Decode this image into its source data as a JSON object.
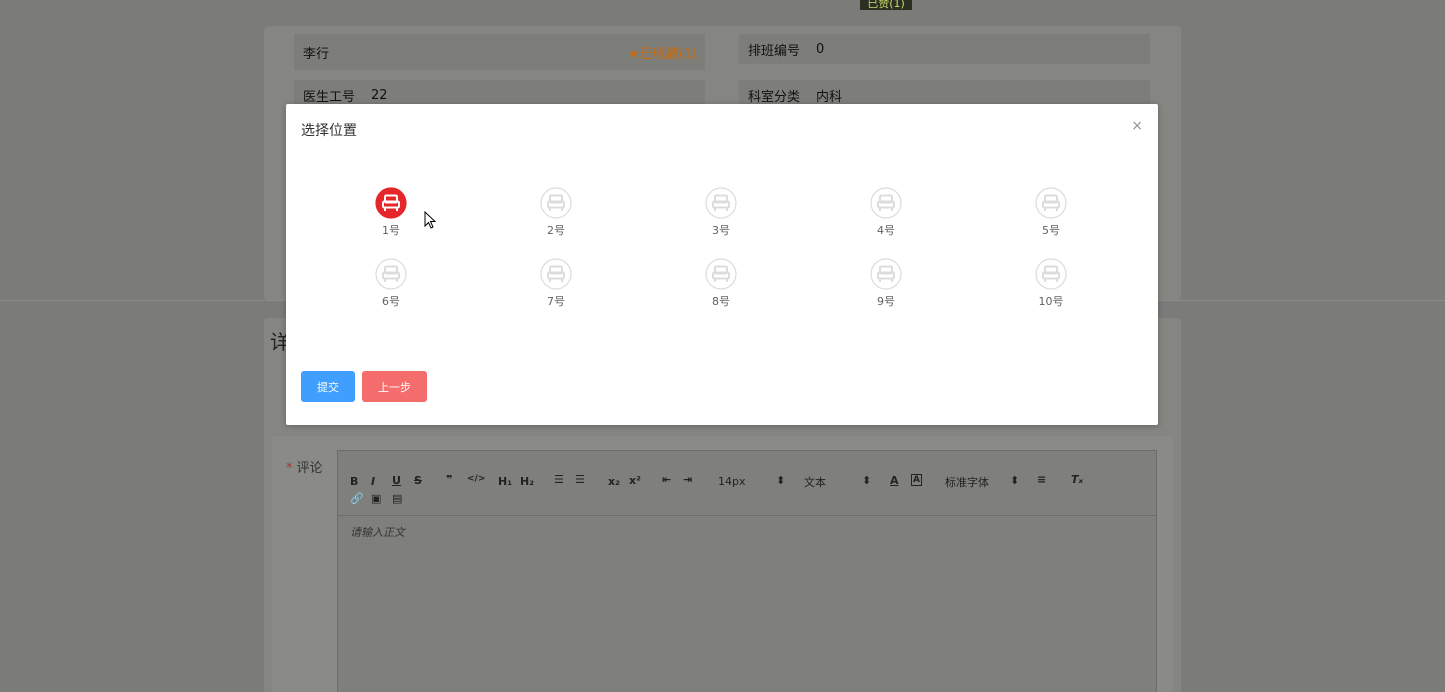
{
  "background": {
    "badge_text": "已赞(1)",
    "doctor_name": "李行",
    "favorite_label": "★已收藏(1)",
    "schedule_key": "排班编号",
    "schedule_value": "0",
    "doctor_id_key": "医生工号",
    "doctor_id_value": "22",
    "dept_key": "科室分类",
    "dept_value": "内科",
    "detail_title": "详",
    "comment_label": "评论",
    "comment_required_mark": "*",
    "editor": {
      "font_size": "14px",
      "text_type": "文本",
      "font_family": "标准字体",
      "placeholder": "请输入正文"
    }
  },
  "modal": {
    "title": "选择位置",
    "close_glyph": "×",
    "seats": [
      {
        "label": "1号",
        "selected": true
      },
      {
        "label": "2号",
        "selected": false
      },
      {
        "label": "3号",
        "selected": false
      },
      {
        "label": "4号",
        "selected": false
      },
      {
        "label": "5号",
        "selected": false
      },
      {
        "label": "6号",
        "selected": false
      },
      {
        "label": "7号",
        "selected": false
      },
      {
        "label": "8号",
        "selected": false
      },
      {
        "label": "9号",
        "selected": false
      },
      {
        "label": "10号",
        "selected": false
      }
    ],
    "submit_label": "提交",
    "back_label": "上一步"
  },
  "colors": {
    "selected_seat": "#e5262b",
    "unselected_seat": "#dcdcdc",
    "submit": "#409eff",
    "back": "#f56c6c"
  }
}
